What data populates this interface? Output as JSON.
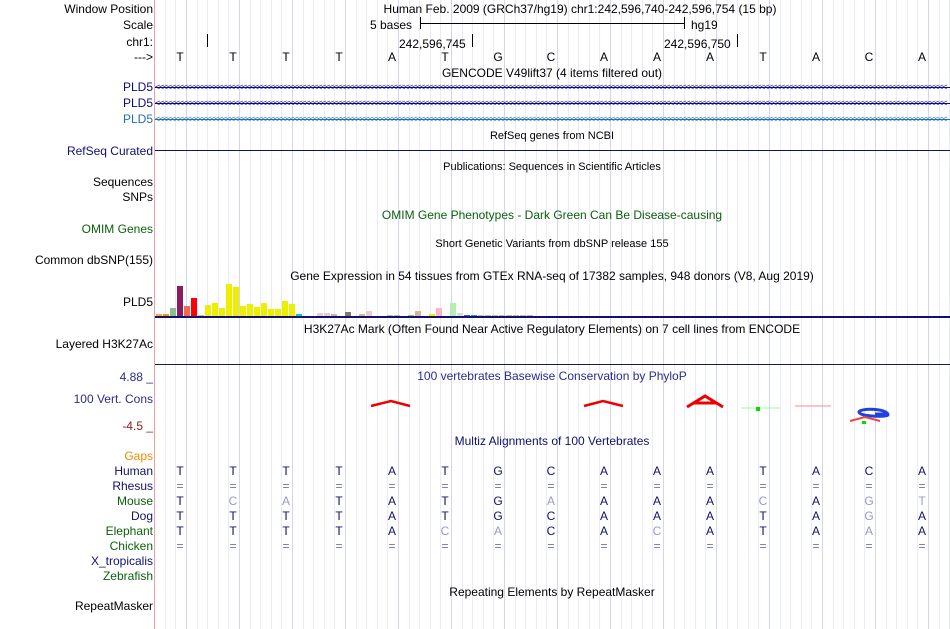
{
  "header": {
    "window_position_label": "Window Position",
    "position_text": "Human Feb. 2009 (GRCh37/hg19)   chr1:242,596,740-242,596,754 (15 bp)",
    "scale_label": "Scale",
    "scale_text": "5 bases",
    "assembly": "hg19",
    "chrom_label": "chr1:",
    "coord1": "242,596,745",
    "coord2": "242,596,750",
    "strand_label": "--->"
  },
  "sequence": [
    "T",
    "T",
    "T",
    "T",
    "A",
    "T",
    "G",
    "C",
    "A",
    "A",
    "A",
    "T",
    "A",
    "C",
    "A"
  ],
  "tracks": {
    "gencode": {
      "title": "GENCODE V49lift37 (4 items filtered out)",
      "genes": [
        {
          "name": "PLD5",
          "color": "#0a0a80"
        },
        {
          "name": "PLD5",
          "color": "#0a0a80"
        },
        {
          "name": "PLD5",
          "color": "#1e6fb5"
        }
      ]
    },
    "refseq": {
      "title": "RefSeq genes from NCBI",
      "label": "RefSeq Curated"
    },
    "publications": {
      "title": "Publications: Sequences in Scientific Articles",
      "labels": [
        "Sequences",
        "SNPs"
      ]
    },
    "omim": {
      "title": "OMIM Gene Phenotypes - Dark Green Can Be Disease-causing",
      "label": "OMIM Genes"
    },
    "dbsnp": {
      "title": "Short Genetic Variants from dbSNP release 155",
      "label": "Common dbSNP(155)"
    },
    "gtex": {
      "title": "Gene Expression in 54 tissues from GTEx RNA-seq of 17382 samples, 948 donors (V8, Aug 2019)",
      "label": "PLD5",
      "levels": [
        2,
        2,
        8,
        30,
        10,
        18,
        1,
        11,
        13,
        8,
        32,
        29,
        10,
        12,
        9,
        13,
        7,
        7,
        15,
        12,
        2,
        0,
        0,
        3,
        3,
        2,
        0,
        4,
        0,
        2,
        5,
        0,
        0,
        1,
        1,
        0,
        1,
        5,
        0,
        2,
        8,
        0,
        13,
        3,
        1,
        1,
        1,
        1,
        1,
        1,
        1,
        1,
        1,
        1
      ],
      "colors": [
        "#ffa54f",
        "#ee9a00",
        "#8fbc8f",
        "#8b1c62",
        "#ee6a50",
        "#ff0000",
        "#cdb79e",
        "#eeee00",
        "#eeee00",
        "#eeee00",
        "#eeee00",
        "#eeee00",
        "#eeee00",
        "#eeee00",
        "#eeee00",
        "#eeee00",
        "#eeee00",
        "#eeee00",
        "#eeee00",
        "#eeee00",
        "#00cdcd",
        "#cccccc",
        "#cccccc",
        "#eecccc",
        "#eecccc",
        "#cdb79e",
        "#cccccc",
        "#8b7765",
        "#cccccc",
        "#cdb79e",
        "#eecccc",
        "#cccccc",
        "#cccccc",
        "#cdb79e",
        "#cdb79e",
        "#cccccc",
        "#9acd32",
        "#cdb79e",
        "#cccccc",
        "#eeee00",
        "#ffb6c1",
        "#cccccc",
        "#b4eeb4",
        "#d9d9d9",
        "#3a5fcd",
        "#1e90ff",
        "#cdb79e",
        "#cdb79e",
        "#cdb79e",
        "#cdb79e",
        "#cdb79e",
        "#cdb79e",
        "#cdb79e",
        "#cdb79e"
      ]
    },
    "h3k27ac": {
      "title": "H3K27Ac Mark (Often Found Near Active Regulatory Elements) on 7 cell lines from ENCODE",
      "label": "Layered H3K27Ac"
    },
    "phylop": {
      "title": "100 vertebrates Basewise Conservation by PhyloP",
      "label": "100 Vert. Cons",
      "ymax": "4.88 _",
      "ymin": "-4.5 _"
    },
    "multiz": {
      "title": "Multiz Alignments of 100 Vertebrates",
      "gaps_label": "Gaps",
      "species": [
        {
          "name": "Human",
          "color": "#10106e",
          "bases": [
            "T",
            "T",
            "T",
            "T",
            "A",
            "T",
            "G",
            "C",
            "A",
            "A",
            "A",
            "T",
            "A",
            "C",
            "A"
          ],
          "mismatch": []
        },
        {
          "name": "Rhesus",
          "color": "#10106e",
          "bases": [
            "=",
            "=",
            "=",
            "=",
            "=",
            "=",
            "=",
            "=",
            "=",
            "=",
            "=",
            "=",
            "=",
            "=",
            "="
          ],
          "mismatch": []
        },
        {
          "name": "Mouse",
          "color": "#0b610b",
          "bases": [
            "T",
            "C",
            "A",
            "T",
            "A",
            "T",
            "G",
            "A",
            "A",
            "A",
            "A",
            "C",
            "A",
            "G",
            "T"
          ],
          "mismatch": [
            1,
            2,
            7,
            11,
            13,
            14
          ]
        },
        {
          "name": "Dog",
          "color": "#10106e",
          "bases": [
            "T",
            "T",
            "T",
            "T",
            "A",
            "T",
            "G",
            "C",
            "A",
            "A",
            "A",
            "T",
            "A",
            "G",
            "A"
          ],
          "mismatch": [
            13
          ]
        },
        {
          "name": "Elephant",
          "color": "#0b610b",
          "bases": [
            "T",
            "T",
            "T",
            "T",
            "A",
            "C",
            "A",
            "C",
            "A",
            "C",
            "A",
            "T",
            "A",
            "A",
            "A"
          ],
          "mismatch": [
            5,
            6,
            9,
            13
          ]
        },
        {
          "name": "Chicken",
          "color": "#0b610b",
          "bases": [
            "=",
            "=",
            "=",
            "=",
            "=",
            "=",
            "=",
            "=",
            "=",
            "=",
            "=",
            "=",
            "=",
            "=",
            "="
          ],
          "mismatch": []
        },
        {
          "name": "X_tropicalis",
          "color": "#10106e",
          "bases": [],
          "mismatch": []
        },
        {
          "name": "Zebrafish",
          "color": "#0b610b",
          "bases": [],
          "mismatch": []
        }
      ]
    },
    "repeatmasker": {
      "title": "Repeating Elements by RepeatMasker",
      "label": "RepeatMasker"
    }
  }
}
